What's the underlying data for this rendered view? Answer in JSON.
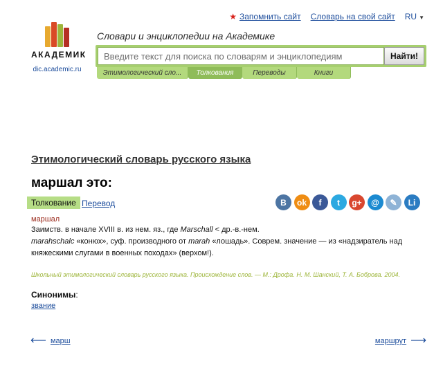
{
  "header": {
    "bookmark_label": "Запомнить сайт",
    "dict_on_site_label": "Словарь на свой сайт",
    "lang": "RU"
  },
  "logo": {
    "word": "АКАДЕМИК",
    "domain": "dic.academic.ru"
  },
  "search": {
    "tagline": "Словари и энциклопедии на Академике",
    "placeholder": "Введите текст для поиска по словарям и энциклопедиям",
    "button_label": "Найти!",
    "tabs": [
      {
        "label": "Этимологический сло..."
      },
      {
        "label": "Толкования"
      },
      {
        "label": "Переводы"
      },
      {
        "label": "Книги"
      }
    ]
  },
  "article": {
    "dictionary_title": "Этимологический словарь русского языка",
    "word_title": "маршал это:",
    "tab_active": "Толкование",
    "tab_other": "Перевод",
    "headword": "маршал",
    "line1_a": "Заимств. в начале XVIII в. из нем. яз., где ",
    "line1_i": "Marschall",
    "line1_b": " < др.-в.-нем.",
    "line2_i": "marahschalc",
    "line2_a": " «конюх», суф. производного от ",
    "line2_i2": "marah",
    "line2_b": " «лошадь». Соврем. значение — из «надзиратель над",
    "line3": "княжескими слугами в военных походах» (верхом!).",
    "source": "Школьный этимологический словарь русского языка. Происхождение слов. — М.: Дрофа. Н. М. Шанский, Т. А. Боброва. 2004.",
    "synonyms_label": "Синонимы",
    "synonyms_colon": ":",
    "synonyms": [
      "звание"
    ]
  },
  "social": [
    {
      "name": "vkontakte-icon",
      "glyph": "В",
      "color": "#4d75a3"
    },
    {
      "name": "odnoklassniki-icon",
      "glyph": "ok",
      "color": "#ef8d14"
    },
    {
      "name": "facebook-icon",
      "glyph": "f",
      "color": "#3b5998"
    },
    {
      "name": "twitter-icon",
      "glyph": "t",
      "color": "#2ca9e1"
    },
    {
      "name": "google-plus-icon",
      "glyph": "g+",
      "color": "#d9472f"
    },
    {
      "name": "email-icon",
      "glyph": "@",
      "color": "#1b8ad1"
    },
    {
      "name": "livejournal-icon",
      "glyph": "✎",
      "color": "#8eb3d6"
    },
    {
      "name": "liveinternet-icon",
      "glyph": "Li",
      "color": "#2b7cc2"
    }
  ],
  "nav": {
    "prev_label": "марш",
    "next_label": "маршрут",
    "prev_arrow": "⟵",
    "next_arrow": "⟶"
  }
}
